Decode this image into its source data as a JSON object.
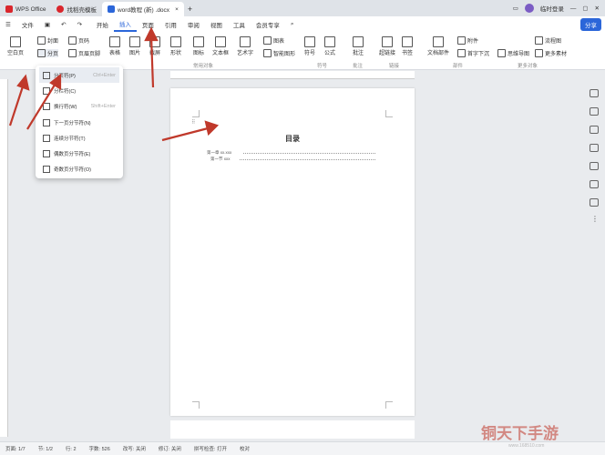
{
  "tabs": [
    {
      "label": "WPS Office",
      "color": "#d9262c"
    },
    {
      "label": "找稻壳模板",
      "color": "#d9262c"
    },
    {
      "label": "word教程 (新) .docx",
      "color": "#2b66d9"
    }
  ],
  "user_label": "临时登录",
  "menu": {
    "file": "文件",
    "items": [
      "开始",
      "插入",
      "页面",
      "引用",
      "审阅",
      "视图",
      "工具",
      "会员专享"
    ],
    "active": "插入",
    "share": "分享"
  },
  "ribbon": {
    "blank_page": "空白页",
    "cover": "封面",
    "break": "分页",
    "header_footer": "页眉页脚",
    "page_num": "页码",
    "table": "表格",
    "picture": "图片",
    "screenshot": "截屏",
    "shape": "形状",
    "icon": "图标",
    "chart_rb": "图表",
    "textbox": "文本框",
    "art": "艺术字",
    "smart_graphic": "智能图形",
    "symbol": "符号",
    "formula": "公式",
    "comment": "批注",
    "hyperlink": "超链接",
    "bookmark": "书签",
    "doc_parts": "文档部件",
    "attachment": "附件",
    "drop_cap": "首字下沉",
    "mindmap": "思维导图",
    "flowchart": "流程图",
    "more_material": "更多素材",
    "groups": {
      "common": "常用对象",
      "symbol": "符号",
      "comment": "批注",
      "link": "链接",
      "parts": "部件",
      "more": "更多对象"
    }
  },
  "dropdown": [
    {
      "label": "分页符(P)",
      "shortcut": "Ctrl+Enter"
    },
    {
      "label": "分栏符(C)",
      "shortcut": ""
    },
    {
      "label": "换行符(W)",
      "shortcut": "Shift+Enter"
    },
    {
      "label": "下一页分节符(N)",
      "shortcut": ""
    },
    {
      "label": "连续分节符(T)",
      "shortcut": ""
    },
    {
      "label": "偶数页分节符(E)",
      "shortcut": ""
    },
    {
      "label": "奇数页分节符(O)",
      "shortcut": ""
    }
  ],
  "document": {
    "toc_title": "目录",
    "toc_rows": [
      {
        "text": "第一章 xx.xxx"
      },
      {
        "text": "第一节 xxx"
      }
    ]
  },
  "status": {
    "page": "页面: 1/7",
    "section": "节: 1/2",
    "row": "行: 2",
    "words": "字数: 526",
    "revise": "改写: 关闭",
    "track": "修订: 关闭",
    "spell": "拼写检查: 打开",
    "proof": "校对"
  },
  "watermark": {
    "text": "铜天下手游",
    "url": "www.168510.com"
  }
}
